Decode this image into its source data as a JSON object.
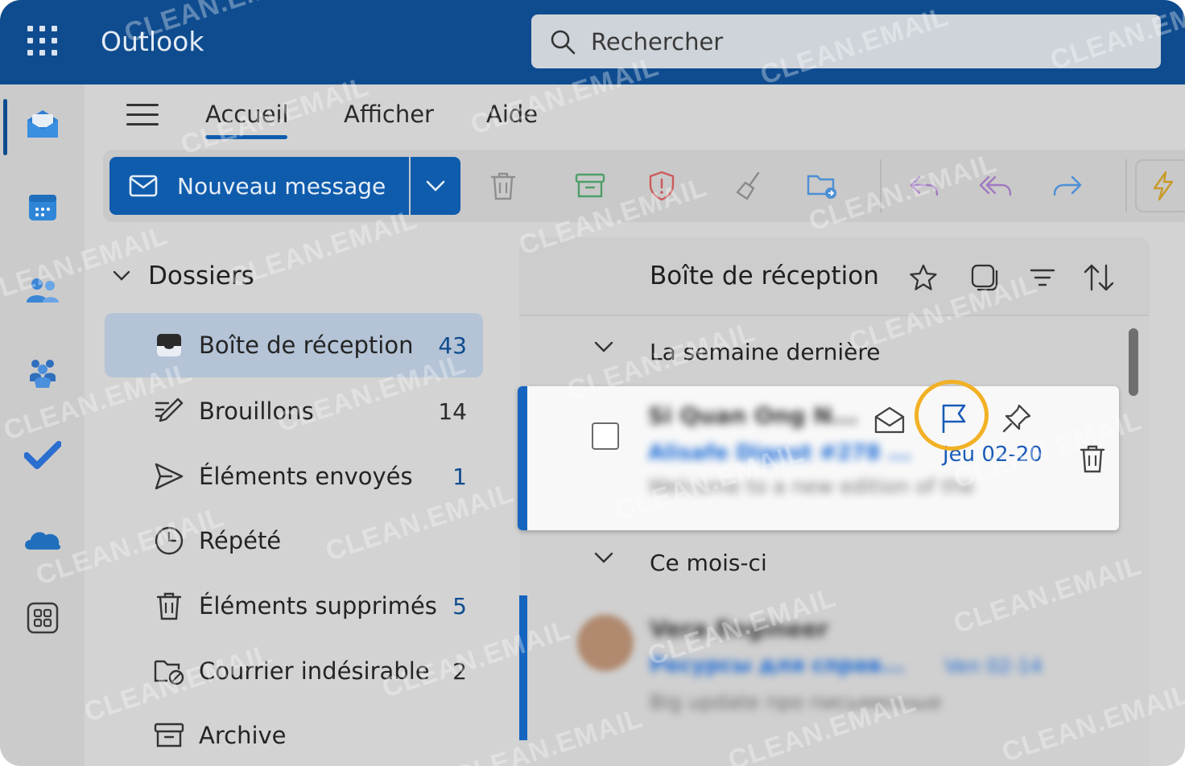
{
  "app": {
    "title": "Outlook",
    "search_placeholder": "Rechercher"
  },
  "nav_tabs": [
    {
      "label": "Accueil",
      "active": true
    },
    {
      "label": "Afficher"
    },
    {
      "label": "Aide"
    }
  ],
  "ribbon": {
    "new_message_label": "Nouveau message",
    "icons": [
      "trash-icon",
      "archive-icon",
      "report-icon",
      "sweep-icon",
      "move-folder-icon",
      "reply-icon",
      "reply-all-icon",
      "forward-icon",
      "quick-steps-icon"
    ]
  },
  "folders": {
    "title": "Dossiers",
    "items": [
      {
        "label": "Boîte de réception",
        "count": "43",
        "active": true,
        "icon": "inbox-icon"
      },
      {
        "label": "Brouillons",
        "count": "14",
        "icon": "drafts-icon"
      },
      {
        "label": "Éléments envoyés",
        "count": "1",
        "icon": "sent-icon"
      },
      {
        "label": "Répété",
        "count": "",
        "icon": "clock-icon"
      },
      {
        "label": "Éléments supprimés",
        "count": "5",
        "icon": "trash-icon"
      },
      {
        "label": "Courrier indésirable",
        "count": "2",
        "icon": "junk-icon"
      },
      {
        "label": "Archive",
        "count": "",
        "icon": "archive-icon"
      }
    ]
  },
  "message_list": {
    "title": "Boîte de réception",
    "groups": [
      {
        "label": "La semaine dernière"
      },
      {
        "label": "Ce mois-ci"
      }
    ],
    "messages": [
      {
        "sender": "Si Quan Ong N...",
        "subject": "Alisafe Digest #278 ...",
        "date": "Jeu 02-20",
        "preview": "Welcome to a new edition of the",
        "selected": true
      },
      {
        "sender": "Vera Engineer",
        "subject": "Ресурсы для справ...",
        "date": "Ven 02-14",
        "preview": "Big update про письменные"
      }
    ]
  },
  "watermark_text": "CLEAN.EMAIL",
  "colors": {
    "brand": "#0f4c8f",
    "accent": "#0f5cad",
    "highlight_ring": "#f2b125"
  }
}
